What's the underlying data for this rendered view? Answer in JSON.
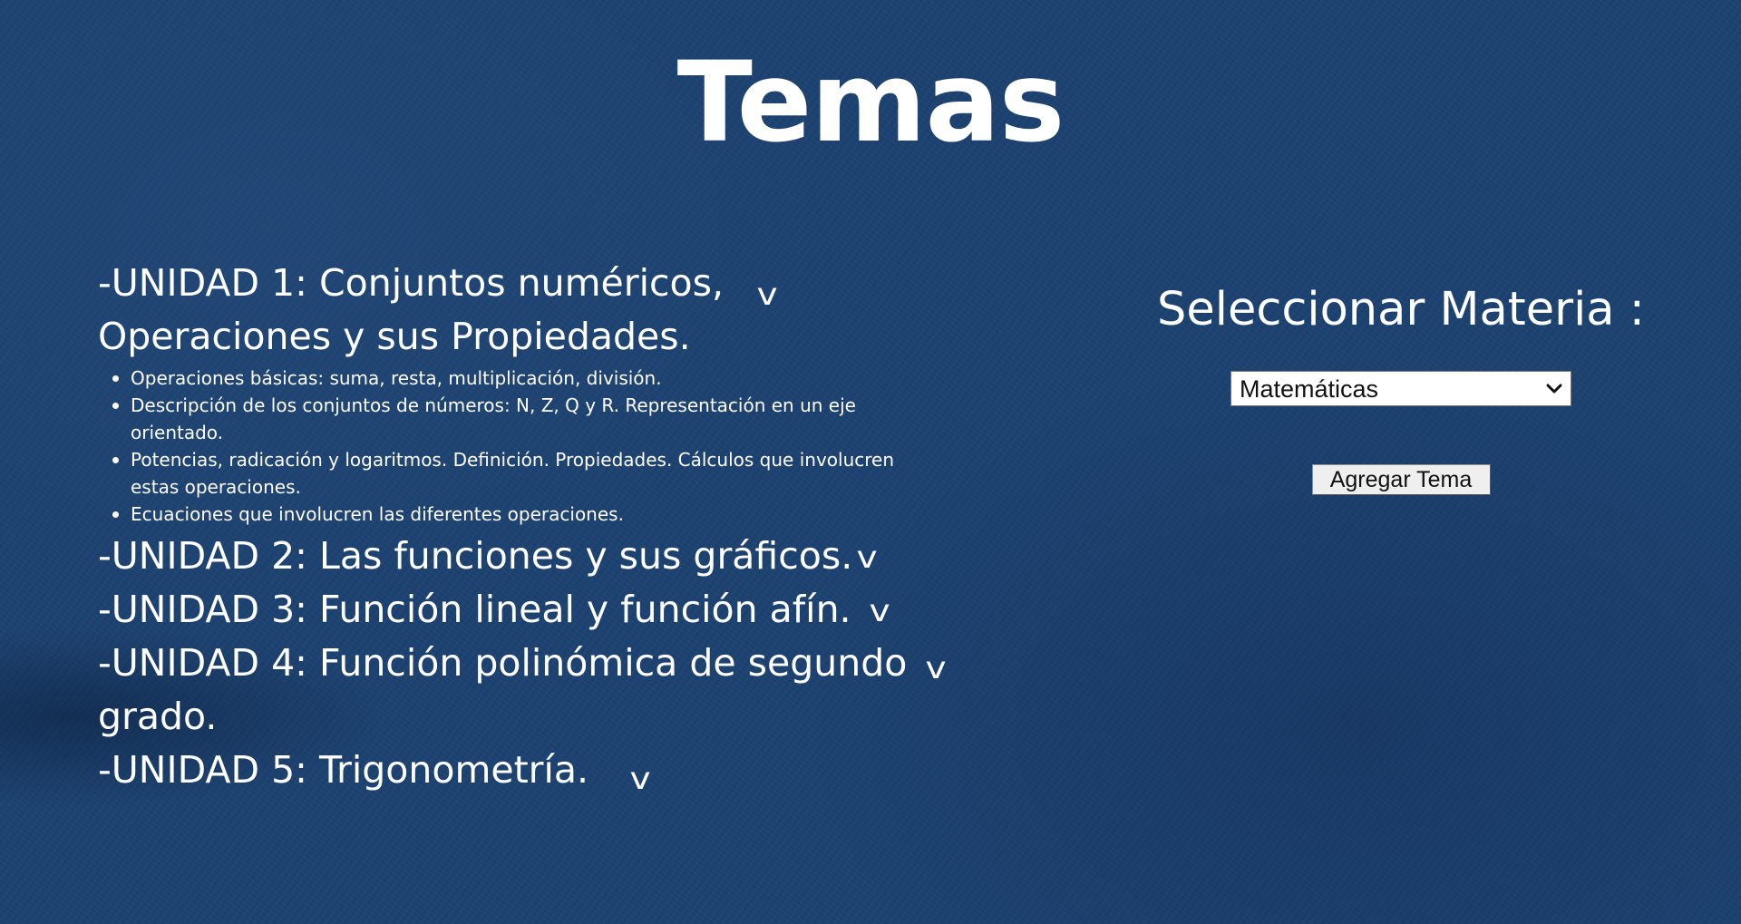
{
  "page": {
    "title": "Temas"
  },
  "units": [
    {
      "title": "-UNIDAD 1: Conjuntos numéricos, Operaciones y sus Propiedades.",
      "expand_icon": "v",
      "subtopics": [
        "Operaciones básicas: suma, resta, multiplicación, división.",
        "Descripción de los conjuntos de números: N, Z, Q y R. Representación en un eje orientado.",
        "Potencias, radicación y logaritmos. Definición. Propiedades. Cálculos que involucren estas operaciones.",
        "Ecuaciones que involucren las diferentes operaciones."
      ]
    },
    {
      "title": "-UNIDAD 2: Las funciones y sus gráficos.",
      "expand_icon": "v"
    },
    {
      "title": "-UNIDAD 3: Función lineal y función afín.",
      "expand_icon": "v"
    },
    {
      "title": "-UNIDAD 4: Función polinómica de segundo grado.",
      "expand_icon": "v"
    },
    {
      "title": "-UNIDAD 5: Trigonometría.",
      "expand_icon": "v"
    }
  ],
  "sidebar": {
    "title": "Seleccionar Materia :",
    "subject_select": {
      "value": "Matemáticas"
    },
    "add_button_label": "Agregar Tema"
  },
  "icons": {
    "unit_toggle": "chevron-down-icon",
    "select_toggle": "chevron-down-icon"
  },
  "colors": {
    "background": "#1c4270",
    "text": "#ffffff",
    "control_background": "#ffffff",
    "button_background": "#efefef"
  }
}
